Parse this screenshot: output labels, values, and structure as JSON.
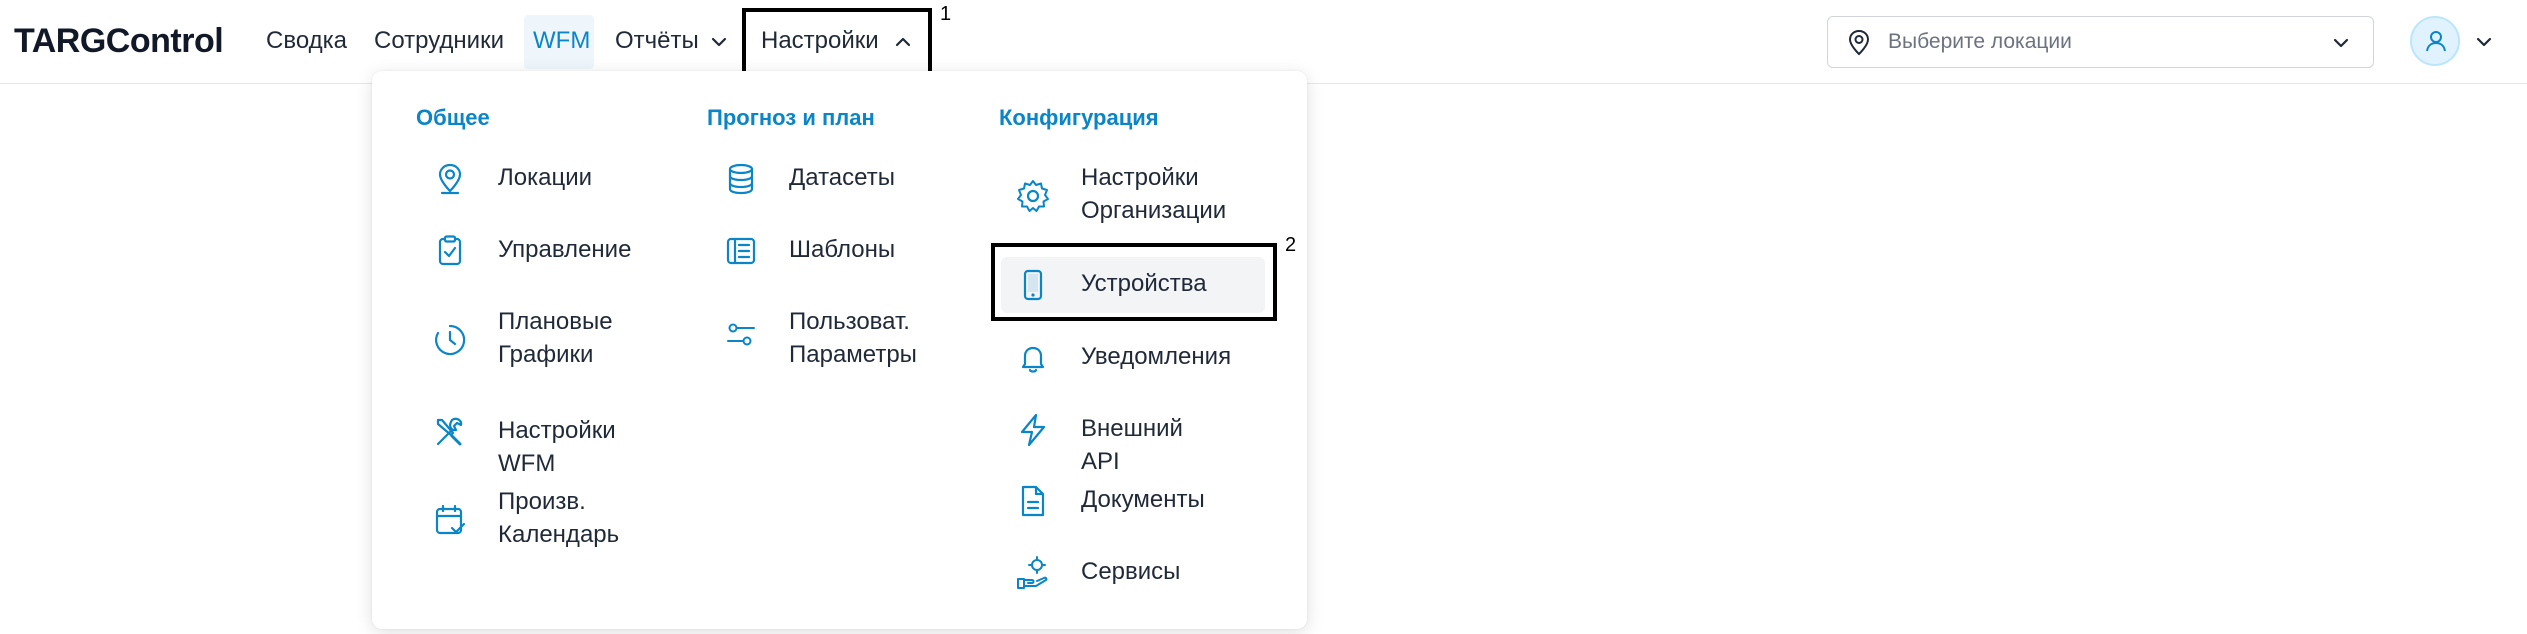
{
  "app": {
    "logo": "TARGControl"
  },
  "nav": {
    "items": [
      {
        "label": "Сводка"
      },
      {
        "label": "Сотрудники"
      },
      {
        "label": "WFM"
      },
      {
        "label": "Отчёты"
      },
      {
        "label": "Настройки"
      }
    ]
  },
  "location_select": {
    "placeholder": "Выберите локации"
  },
  "annotations": {
    "one": "1",
    "two": "2"
  },
  "dropdown": {
    "columns": [
      {
        "title": "Общее",
        "items": [
          {
            "label": "Локации",
            "icon": "location-pin-icon"
          },
          {
            "label": "Управление",
            "icon": "clipboard-check-icon"
          },
          {
            "label": "Плановые Графики",
            "icon": "clock-icon"
          },
          {
            "label": "Настройки WFM",
            "icon": "tools-icon"
          },
          {
            "label": "Произв. Календарь",
            "icon": "calendar-check-icon"
          }
        ]
      },
      {
        "title": "Прогноз и план",
        "items": [
          {
            "label": "Датасеты",
            "icon": "database-icon"
          },
          {
            "label": "Шаблоны",
            "icon": "template-icon"
          },
          {
            "label": "Пользоват. Параметры",
            "icon": "sliders-icon"
          }
        ]
      },
      {
        "title": "Конфигурация",
        "items": [
          {
            "label": "Настройки Организации",
            "icon": "gear-icon"
          },
          {
            "label": "Устройства",
            "icon": "phone-icon"
          },
          {
            "label": "Уведомления",
            "icon": "bell-icon"
          },
          {
            "label": "Внешний API",
            "icon": "lightning-icon"
          },
          {
            "label": "Документы",
            "icon": "document-icon"
          },
          {
            "label": "Сервисы",
            "icon": "service-hand-icon"
          }
        ]
      }
    ]
  },
  "colors": {
    "accent": "#0a85c7",
    "text": "#1f2937",
    "highlight": "#f3f4f6"
  }
}
